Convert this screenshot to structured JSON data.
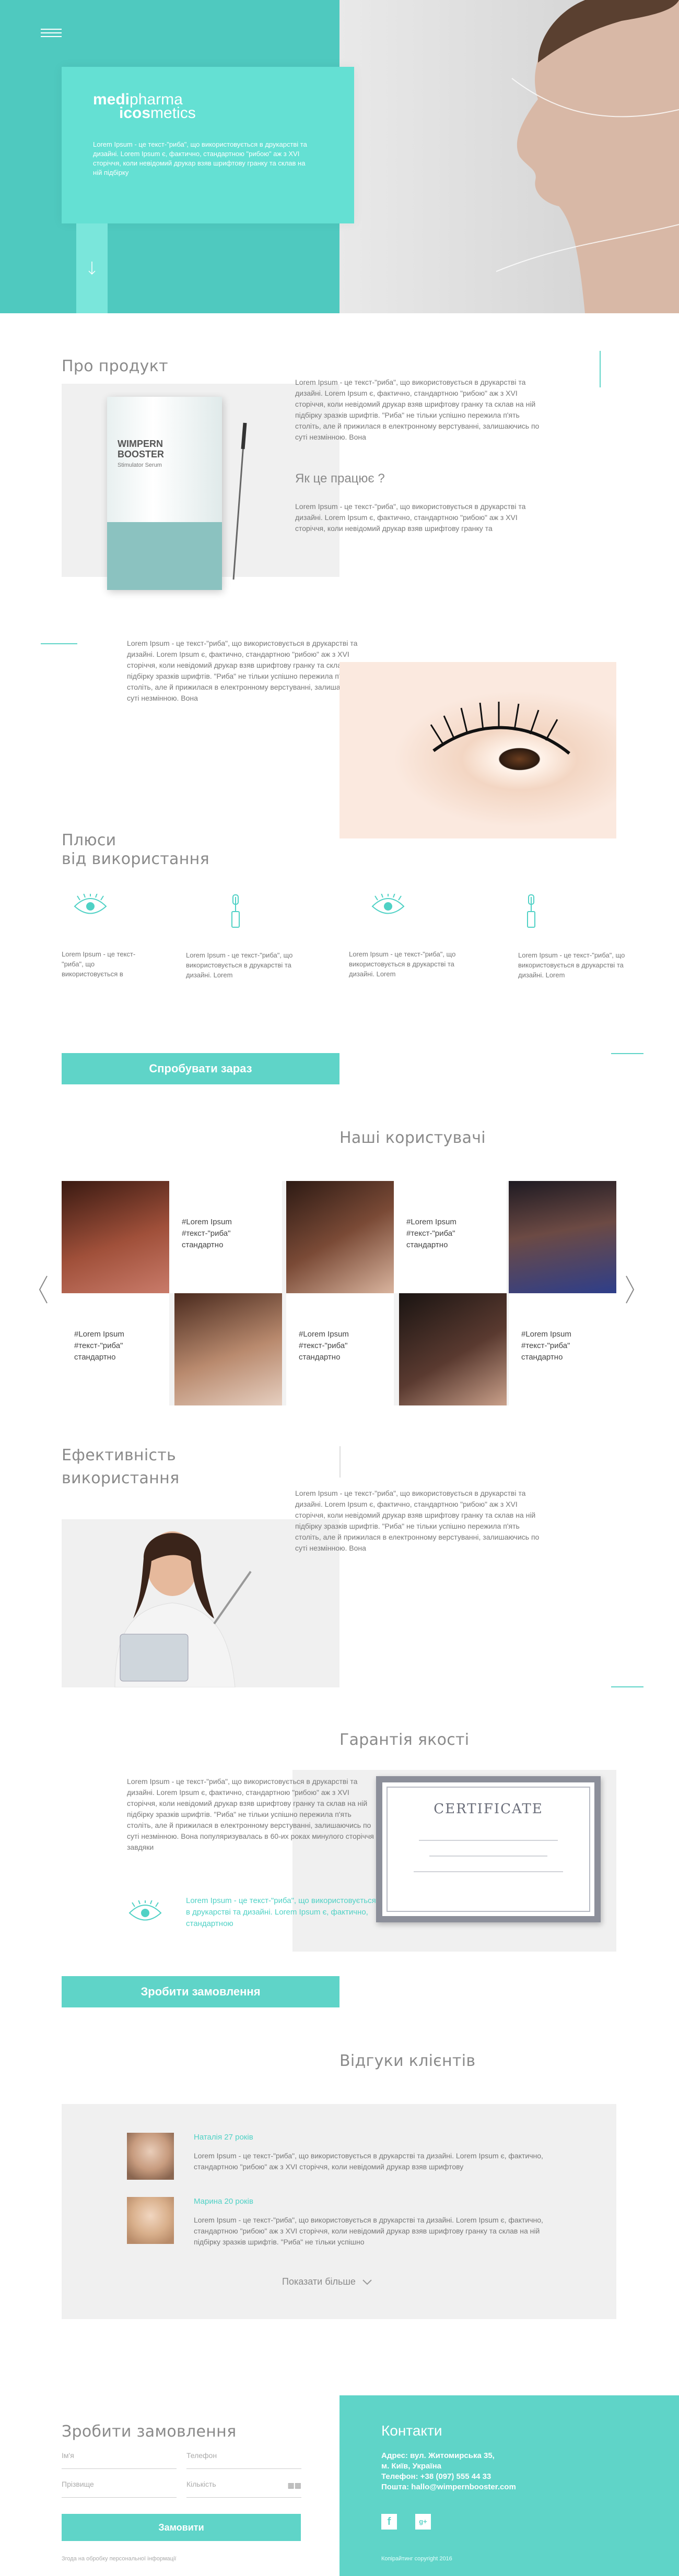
{
  "hero": {
    "menu_icon": "hamburger-icon",
    "logo_medi": "medi",
    "logo_pharma": "pharma",
    "logo_icos": "icos",
    "logo_metics": "metics",
    "text": "Lorem Ipsum - це текст-\"риба\", що використовується в друкарстві та дизайні. Lorem Ipsum є, фактично, стандартною \"рибою\" аж з XVI сторіччя, коли невідомий друкар взяв шрифтову гранку та склав на ній підбірку",
    "arrow_icon": "arrow-down-icon"
  },
  "about": {
    "title": "Про продукт",
    "product_name": "WIMPERN BOOSTER",
    "product_sub": "Stimulator Serum",
    "text1": "Lorem Ipsum - це текст-\"риба\", що використовується в друкарстві та дизайні. Lorem Ipsum є, фактично, стандартною \"рибою\" аж з XVI сторіччя, коли невідомий друкар взяв шрифтову гранку та склав на ній підбірку зразків шрифтів. \"Риба\" не тільки успішно пережила п'ять століть, але й прижилася в електронному верстуванні, залишаючись по суті незмінною. Вона",
    "how_title": "Як це працює ?",
    "text2": "Lorem Ipsum - це текст-\"риба\", що використовується в друкарстві та дизайні. Lorem Ipsum є, фактично, стандартною \"рибою\" аж з XVI сторіччя, коли невідомий друкар взяв шрифтову гранку та",
    "text3": "Lorem Ipsum - це текст-\"риба\", що використовується в друкарстві та дизайні. Lorem Ipsum є, фактично, стандартною \"рибою\" аж з XVI сторіччя, коли невідомий друкар взяв шрифтову гранку та склав на ній підбірку зразків шрифтів. \"Риба\" не тільки успішно пережила п'ять століть, але й прижилася в електронному верстуванні, залишаючись по суті незмінною. Вона"
  },
  "benefits": {
    "title_line1": "Плюси",
    "title_line2": "від використання",
    "items": [
      {
        "icon": "eye-icon",
        "text": "Lorem Ipsum - це текст-\"риба\", що використовується в"
      },
      {
        "icon": "mascara-icon",
        "text": "Lorem Ipsum - це текст-\"риба\", що використовується в друкарстві та дизайні. Lorem"
      },
      {
        "icon": "eye-icon",
        "text": "Lorem Ipsum - це текст-\"риба\", що використовується в друкарстві та дизайні. Lorem"
      },
      {
        "icon": "mascara-icon",
        "text": "Lorem Ipsum - це текст-\"риба\", що використовується в друкарстві та дизайні. Lorem"
      }
    ],
    "cta": "Спробувати зараз"
  },
  "users": {
    "title": "Наші користувачі",
    "caption": "#Lorem Ipsum #текст-\"риба\" стандартно",
    "caption_line1": "#Lorem Ipsum",
    "caption_line2": "#текст-\"риба\"",
    "caption_line3": "стандартно",
    "prev_icon": "chevron-left-icon",
    "next_icon": "chevron-right-icon"
  },
  "efficiency": {
    "title_line1": "Ефективність",
    "title_line2": "використання",
    "text": "Lorem Ipsum - це текст-\"риба\", що використовується в друкарстві та дизайні. Lorem Ipsum є, фактично, стандартною \"рибою\" аж з XVI сторіччя, коли невідомий друкар взяв шрифтову гранку та склав на ній підбірку зразків шрифтів. \"Риба\" не тільки успішно пережила п'ять століть, але й прижилася в електронному верстуванні, залишаючись по суті незмінною. Вона"
  },
  "quality": {
    "title": "Гарантія якості",
    "text": "Lorem Ipsum - це текст-\"риба\", що використовується в друкарстві та дизайні. Lorem Ipsum є, фактично, стандартною \"рибою\" аж з XVI сторіччя, коли невідомий друкар взяв шрифтову гранку та склав на ній підбірку зразків шрифтів. \"Риба\" не тільки успішно пережила п'ять століть, але й прижилася в електронному верстуванні, залишаючись по суті незмінною. Вона популяризувалась в 60-их роках минулого сторіччя завдяки",
    "highlight": "Lorem Ipsum - це текст-\"риба\", що використовується в друкарстві та дизайні. Lorem Ipsum є, фактично, стандартною",
    "cert_title": "CERTIFICATE",
    "cta": "Зробити замовлення"
  },
  "reviews": {
    "title": "Відгуки клієнтів",
    "items": [
      {
        "name": "Наталія 27 років",
        "text": "Lorem Ipsum - це текст-\"риба\", що використовується в друкарстві та дизайні. Lorem Ipsum є, фактично, стандартною \"рибою\" аж з XVI сторіччя, коли невідомий друкар взяв шрифтову"
      },
      {
        "name": "Марина 20 років",
        "text": "Lorem Ipsum - це текст-\"риба\", що використовується в друкарстві та дизайні. Lorem Ipsum є, фактично, стандартною \"рибою\" аж з XVI сторіччя, коли невідомий друкар взяв шрифтову гранку та склав на ній підбірку зразків шрифтів. \"Риба\" не тільки успішно"
      }
    ],
    "more": "Показати більше"
  },
  "order": {
    "title": "Зробити замовлення",
    "name_placeholder": "Ім'я",
    "phone_placeholder": "Телефон",
    "surname_placeholder": "Прізвище",
    "qty_placeholder": "Кількість",
    "submit": "Замовити",
    "footer_note": "Згода на обробку персональної інформації"
  },
  "contacts": {
    "title": "Контакти",
    "address": "Адрес: вул. Житомирська 35,",
    "city": "м. Київ, Україна",
    "phone": "Телефон: +38 (097) 555 44 33",
    "email": "Пошта: hallo@wimpernbooster.com",
    "copyright": "Копірайтинг copyright 2016"
  },
  "colors": {
    "accent": "#5fd4c8",
    "hero_bg": "#4fc9bf",
    "grey": "#f0f0f0"
  }
}
